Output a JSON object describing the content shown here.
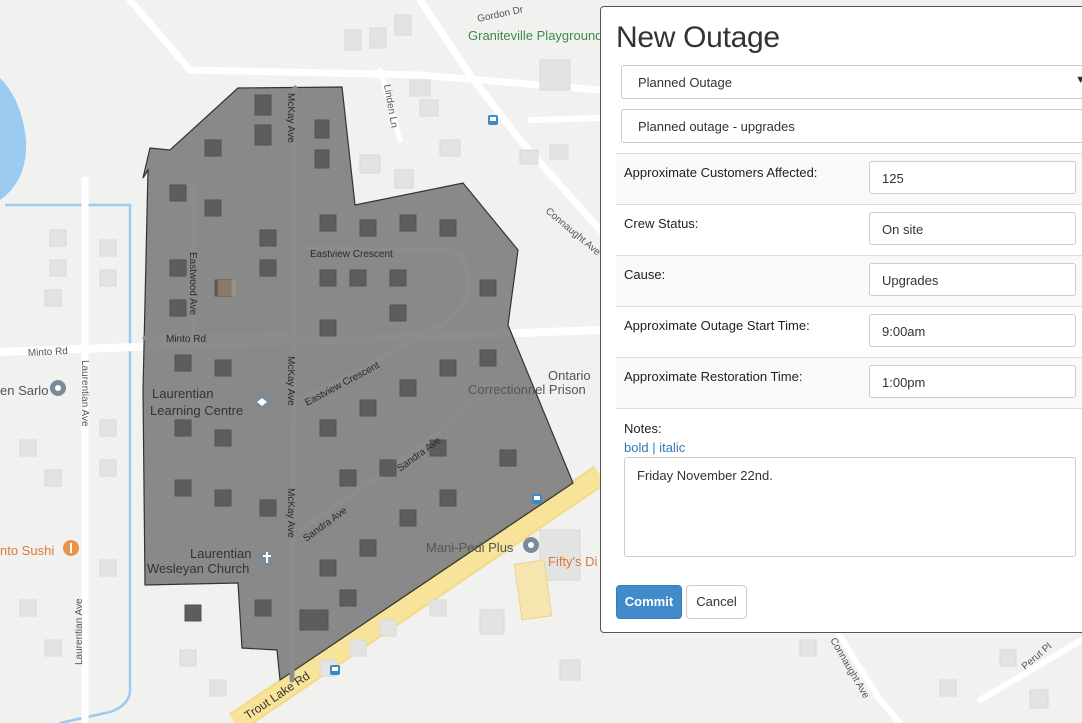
{
  "map": {
    "streets": {
      "gordon": "Gordon Dr",
      "linden": "Linden Ln",
      "connaught": "Connaught Ave",
      "connaught_lower": "Connaught Ave",
      "mckay": "McKay Ave",
      "eastview": "Eastview Crescent",
      "eastwood": "Eastwood Ave",
      "minto": "Minto Rd",
      "laurentian": "Laurentian Ave",
      "sandra": "Sandra Ave",
      "trout": "Trout Lake Rd",
      "perut": "Perut Pl"
    },
    "places": {
      "playground": "Graniteville Playground",
      "learning_line1": "Laurentian",
      "learning_line2": "Learning Centre",
      "church_line1": "Laurentian",
      "church_line2": "Wesleyan Church",
      "prison_line1": "Ontario",
      "prison_line2": "Correctionnel Prison",
      "manipedi": "Mani-Pedi Plus",
      "fiftys": "Fifty's Di",
      "sarlo": "en Sarlo",
      "sushi": "nto Sushi"
    },
    "colors": {
      "outage_fill": "#6f6f6f",
      "park_label": "#3a8a4a",
      "food_label": "#d77b3a"
    }
  },
  "dialog": {
    "title": "New Outage",
    "outage_type": "Planned Outage",
    "description": "Planned outage - upgrades",
    "fields": [
      {
        "label": "Approximate Customers Affected:",
        "value": "125"
      },
      {
        "label": "Crew Status:",
        "value": "On site"
      },
      {
        "label": "Cause:",
        "value": "Upgrades"
      },
      {
        "label": "Approximate Outage Start Time:",
        "value": "9:00am"
      },
      {
        "label": "Approximate Restoration Time:",
        "value": "1:00pm"
      }
    ],
    "notes_label": "Notes:",
    "format_bold": "bold",
    "format_separator": "|",
    "format_italic": "italic",
    "notes_value": "Friday November 22nd.",
    "commit_label": "Commit",
    "cancel_label": "Cancel"
  }
}
